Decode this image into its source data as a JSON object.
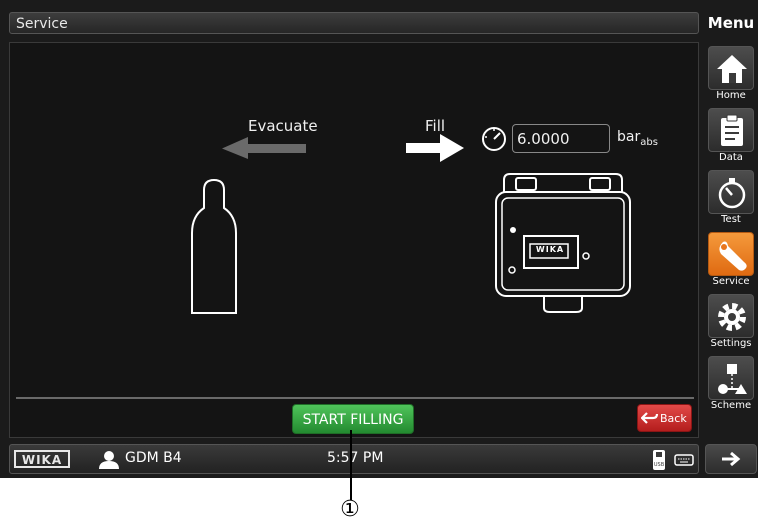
{
  "header": {
    "title": "Service",
    "menu_label": "Menu"
  },
  "diagram": {
    "evacuate_label": "Evacuate",
    "fill_label": "Fill",
    "pressure_value": "6.0000",
    "pressure_unit": "bar",
    "pressure_unit_sub": "abs",
    "device_brand": "WIKA"
  },
  "actions": {
    "start_label": "START FILLING",
    "back_label": "Back"
  },
  "sidebar": {
    "items": [
      {
        "label": "Home",
        "icon": "home-icon"
      },
      {
        "label": "Data",
        "icon": "clipboard-icon"
      },
      {
        "label": "Test",
        "icon": "gauge-icon"
      },
      {
        "label": "Service",
        "icon": "wrench-icon",
        "active": true
      },
      {
        "label": "Settings",
        "icon": "gear-icon"
      },
      {
        "label": "Scheme",
        "icon": "scheme-icon"
      }
    ],
    "active_color": "#f08a2c"
  },
  "statusbar": {
    "brand": "WIKA",
    "user": "GDM B4",
    "time": "5:57 PM"
  },
  "callout": {
    "label": "①"
  },
  "colors": {
    "start_button": "#3aa845",
    "back_button": "#d63232"
  }
}
